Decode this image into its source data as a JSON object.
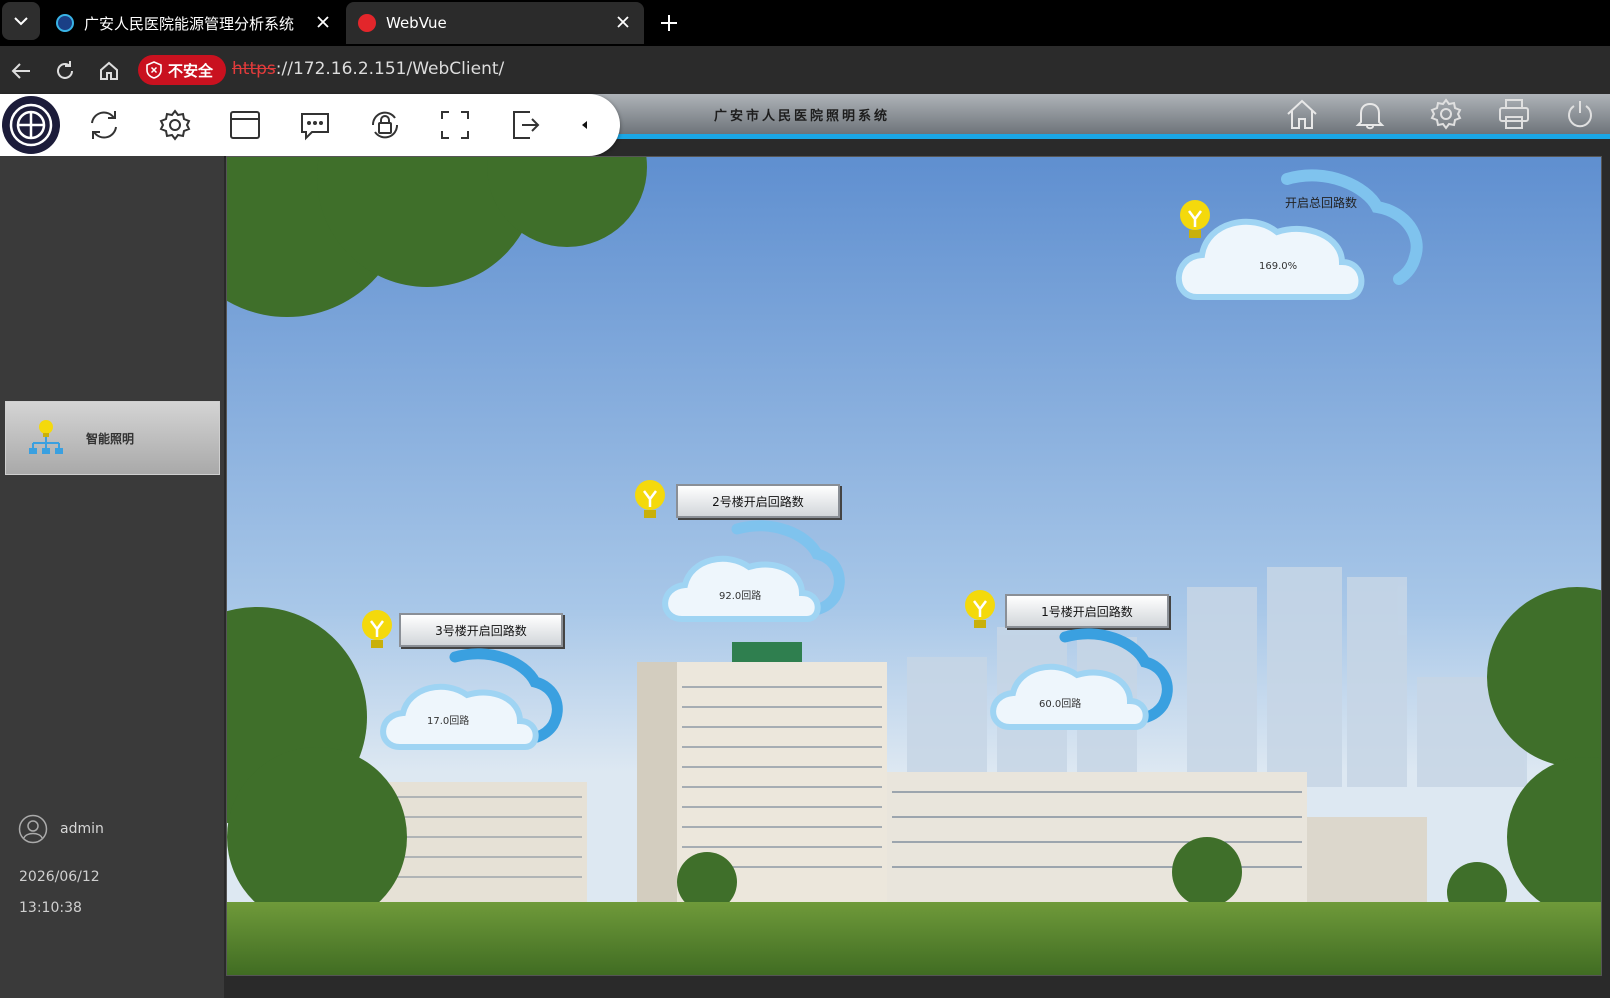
{
  "browser": {
    "tabs": [
      {
        "title": "广安人民医院能源管理分析系统"
      },
      {
        "title": "WebVue"
      }
    ],
    "security_label": "不安全",
    "url_scheme": "https",
    "url_rest": "://172.16.2.151/WebClient/"
  },
  "app": {
    "title": "广安市人民医院照明系统",
    "sidebar": {
      "item_label": "智能照明",
      "user": "admin",
      "date": "2026/06/12",
      "time": "13:10:38"
    },
    "widgets": {
      "total": {
        "label": "开启总回路数",
        "value": "169.0%"
      },
      "bldg2": {
        "label": "2号楼开启回路数",
        "value": "92.0回路"
      },
      "bldg3": {
        "label": "3号楼开启回路数",
        "value": "17.0回路"
      },
      "bldg1": {
        "label": "1号楼开启回路数",
        "value": "60.0回路"
      }
    }
  },
  "colors": {
    "accent": "#1aa7e6",
    "bulb": "#f4d90c",
    "insecure": "#c9111f"
  },
  "icons": [
    "chevron-down-icon",
    "close-icon",
    "plus-icon",
    "back-icon",
    "reload-icon",
    "home-icon",
    "shield-icon",
    "logo-icon",
    "refresh-icon",
    "gear-icon",
    "window-icon",
    "chat-icon",
    "lock-icon",
    "fullscreen-icon",
    "exit-icon",
    "collapse-icon",
    "bell-icon",
    "printer-icon",
    "power-icon",
    "network-icon",
    "user-icon",
    "bulb-icon",
    "cloud-icon"
  ]
}
